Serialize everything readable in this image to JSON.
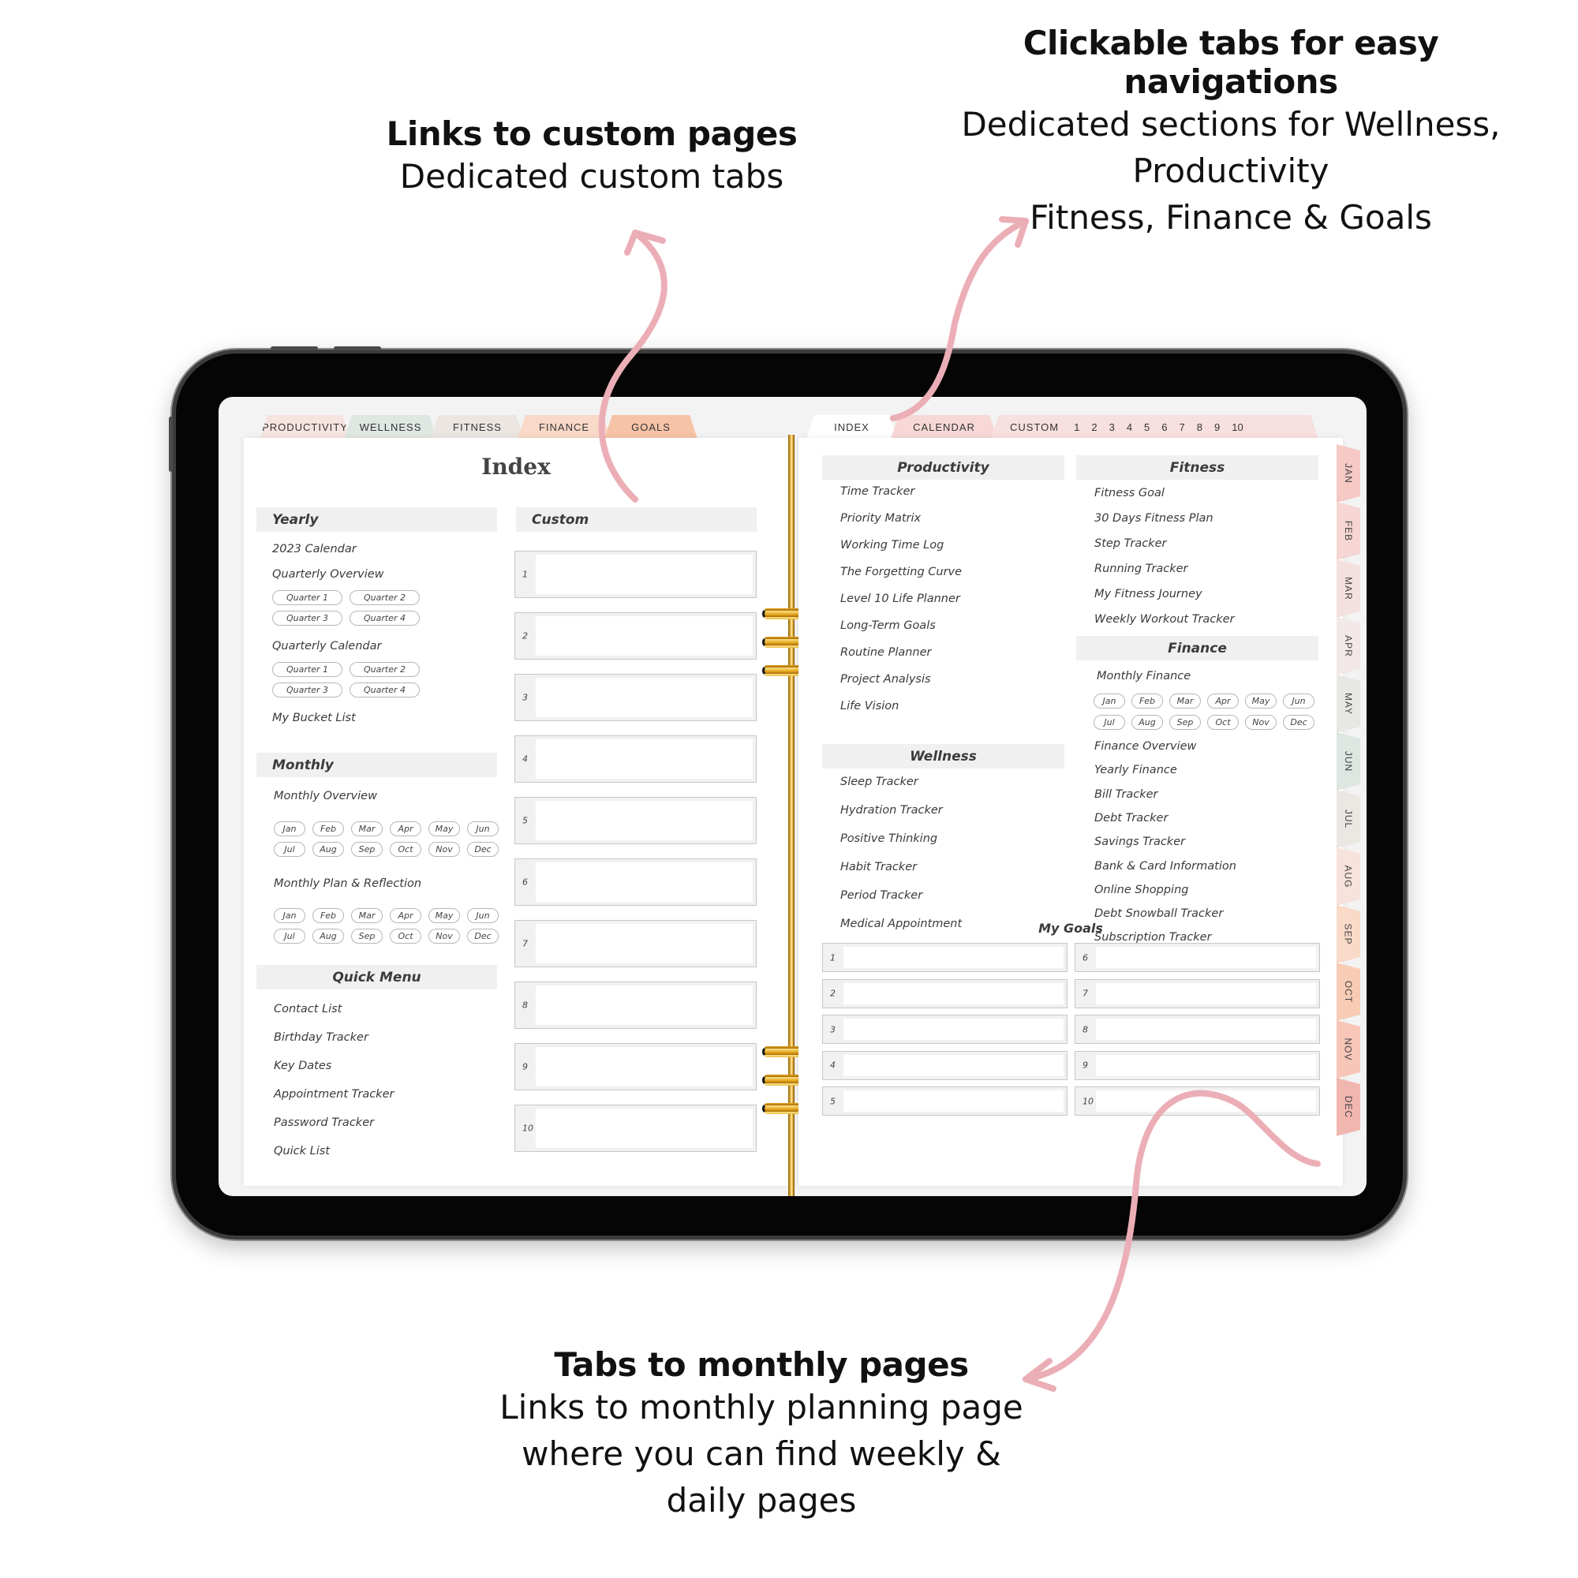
{
  "annotations": {
    "custom_pages": {
      "heading": "Links to custom pages",
      "lines": [
        "Dedicated custom tabs"
      ]
    },
    "clickable_tabs": {
      "heading": "Clickable tabs for easy navigations",
      "lines": [
        "Dedicated sections for Wellness,",
        "Productivity",
        "Fitness, Finance & Goals"
      ]
    },
    "monthly_tabs": {
      "heading": "Tabs to monthly pages",
      "lines": [
        "Links to monthly planning page",
        "where you can find weekly &",
        "daily pages"
      ]
    }
  },
  "colors": {
    "arrow": "#ecaeb6",
    "tab_productivity": "#f6e4e1",
    "tab_wellness": "#dfe7e2",
    "tab_fitness": "#ebe6e1",
    "tab_finance": "#f9d9c8",
    "tab_goals": "#f6c3a7",
    "tab_index": "#ffffff",
    "tab_calendar": "#f7d8d6",
    "tab_custom": "#f7e0df",
    "months": [
      "#f6c9c5",
      "#f6d6d2",
      "#f4e1df",
      "#f2e8e8",
      "#e7e7e4",
      "#dde6e1",
      "#ebe7e3",
      "#f7e3dc",
      "#f9d9c8",
      "#f8ccb4",
      "#f7c6b8",
      "#f2b6b0"
    ]
  },
  "top_tabs_left": [
    {
      "label": "PRODUCTIVITY",
      "color_key": "tab_productivity"
    },
    {
      "label": "WELLNESS",
      "color_key": "tab_wellness"
    },
    {
      "label": "FITNESS",
      "color_key": "tab_fitness"
    },
    {
      "label": "FINANCE",
      "color_key": "tab_finance"
    },
    {
      "label": "GOALS",
      "color_key": "tab_goals"
    }
  ],
  "top_tabs_right": {
    "index": "INDEX",
    "calendar": "CALENDAR",
    "custom": "CUSTOM",
    "custom_numbers": [
      "1",
      "2",
      "3",
      "4",
      "5",
      "6",
      "7",
      "8",
      "9",
      "10"
    ]
  },
  "left_page": {
    "title": "Index",
    "yearly": {
      "heading": "Yearly",
      "calendar": "2023 Calendar",
      "quarterly_overview": "Quarterly Overview",
      "quarterly_overview_pills": [
        "Quarter 1",
        "Quarter 2",
        "Quarter 3",
        "Quarter 4"
      ],
      "quarterly_calendar": "Quarterly Calendar",
      "quarterly_calendar_pills": [
        "Quarter 1",
        "Quarter 2",
        "Quarter 3",
        "Quarter 4"
      ],
      "bucket_list": "My Bucket List"
    },
    "custom": {
      "heading": "Custom",
      "slots": [
        "1",
        "2",
        "3",
        "4",
        "5",
        "6",
        "7",
        "8",
        "9",
        "10"
      ]
    },
    "monthly": {
      "heading": "Monthly",
      "overview": "Monthly Overview",
      "overview_months": [
        "Jan",
        "Feb",
        "Mar",
        "Apr",
        "May",
        "Jun",
        "Jul",
        "Aug",
        "Sep",
        "Oct",
        "Nov",
        "Dec"
      ],
      "plan": "Monthly Plan & Reflection",
      "plan_months": [
        "Jan",
        "Feb",
        "Mar",
        "Apr",
        "May",
        "Jun",
        "Jul",
        "Aug",
        "Sep",
        "Oct",
        "Nov",
        "Dec"
      ]
    },
    "quick_menu": {
      "heading": "Quick Menu",
      "items": [
        "Contact List",
        "Birthday Tracker",
        "Key Dates",
        "Appointment Tracker",
        "Password Tracker",
        "Quick List"
      ]
    }
  },
  "right_page": {
    "productivity": {
      "heading": "Productivity",
      "items": [
        "Time Tracker",
        "Priority Matrix",
        "Working Time Log",
        "The Forgetting Curve",
        "Level 10 Life Planner",
        "Long-Term Goals",
        "Routine Planner",
        "Project Analysis",
        "Life Vision"
      ]
    },
    "fitness": {
      "heading": "Fitness",
      "items": [
        "Fitness Goal",
        "30 Days Fitness Plan",
        "Step Tracker",
        "Running Tracker",
        "My Fitness Journey",
        "Weekly Workout Tracker"
      ]
    },
    "finance": {
      "heading": "Finance",
      "monthly": "Monthly Finance",
      "months": [
        "Jan",
        "Feb",
        "Mar",
        "Apr",
        "May",
        "Jun",
        "Jul",
        "Aug",
        "Sep",
        "Oct",
        "Nov",
        "Dec"
      ],
      "items": [
        "Finance Overview",
        "Yearly Finance",
        "Bill Tracker",
        "Debt Tracker",
        "Savings Tracker",
        "Bank & Card Information",
        "Online Shopping",
        "Debt Snowball Tracker",
        "Subscription Tracker"
      ]
    },
    "wellness": {
      "heading": "Wellness",
      "items": [
        "Sleep Tracker",
        "Hydration Tracker",
        "Positive Thinking",
        "Habit Tracker",
        "Period Tracker",
        "Medical Appointment"
      ]
    },
    "goals": {
      "heading": "My Goals",
      "slots": [
        "1",
        "2",
        "3",
        "4",
        "5",
        "6",
        "7",
        "8",
        "9",
        "10"
      ]
    }
  },
  "month_tabs": [
    "JAN",
    "FEB",
    "MAR",
    "APR",
    "MAY",
    "JUN",
    "JUL",
    "AUG",
    "SEP",
    "OCT",
    "NOV",
    "DEC"
  ]
}
